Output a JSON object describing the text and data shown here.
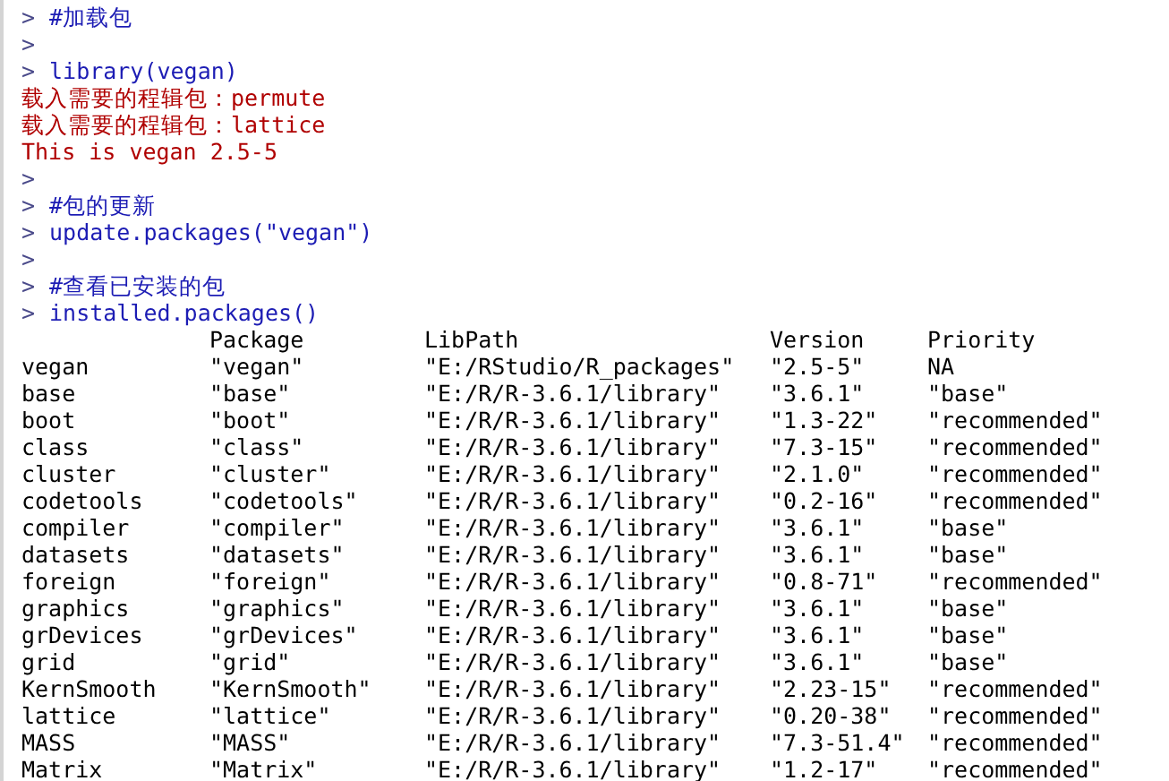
{
  "console": {
    "lines": [
      {
        "kind": "command",
        "prompt": ">",
        "text": "#加载包"
      },
      {
        "kind": "command",
        "prompt": ">"
      },
      {
        "kind": "command",
        "prompt": ">",
        "text": "library(vegan)"
      },
      {
        "kind": "message",
        "text": "载入需要的程辑包：permute"
      },
      {
        "kind": "message",
        "text": "载入需要的程辑包：lattice"
      },
      {
        "kind": "message",
        "text": "This is vegan 2.5-5"
      },
      {
        "kind": "command",
        "prompt": ">"
      },
      {
        "kind": "command",
        "prompt": ">",
        "text": "#包的更新"
      },
      {
        "kind": "command",
        "prompt": ">",
        "text": "update.packages(\"vegan\")"
      },
      {
        "kind": "command",
        "prompt": ">"
      },
      {
        "kind": "command",
        "prompt": ">",
        "text": "#查看已安装的包"
      },
      {
        "kind": "command",
        "prompt": ">",
        "text": "installed.packages()"
      }
    ],
    "table": {
      "columns": [
        "Package",
        "LibPath",
        "Version",
        "Priority"
      ],
      "rows": [
        {
          "name": "vegan",
          "cells": [
            "\"vegan\"",
            "\"E:/RStudio/R_packages\"",
            "\"2.5-5\"",
            "NA"
          ]
        },
        {
          "name": "base",
          "cells": [
            "\"base\"",
            "\"E:/R/R-3.6.1/library\"",
            "\"3.6.1\"",
            "\"base\""
          ]
        },
        {
          "name": "boot",
          "cells": [
            "\"boot\"",
            "\"E:/R/R-3.6.1/library\"",
            "\"1.3-22\"",
            "\"recommended\""
          ]
        },
        {
          "name": "class",
          "cells": [
            "\"class\"",
            "\"E:/R/R-3.6.1/library\"",
            "\"7.3-15\"",
            "\"recommended\""
          ]
        },
        {
          "name": "cluster",
          "cells": [
            "\"cluster\"",
            "\"E:/R/R-3.6.1/library\"",
            "\"2.1.0\"",
            "\"recommended\""
          ]
        },
        {
          "name": "codetools",
          "cells": [
            "\"codetools\"",
            "\"E:/R/R-3.6.1/library\"",
            "\"0.2-16\"",
            "\"recommended\""
          ]
        },
        {
          "name": "compiler",
          "cells": [
            "\"compiler\"",
            "\"E:/R/R-3.6.1/library\"",
            "\"3.6.1\"",
            "\"base\""
          ]
        },
        {
          "name": "datasets",
          "cells": [
            "\"datasets\"",
            "\"E:/R/R-3.6.1/library\"",
            "\"3.6.1\"",
            "\"base\""
          ]
        },
        {
          "name": "foreign",
          "cells": [
            "\"foreign\"",
            "\"E:/R/R-3.6.1/library\"",
            "\"0.8-71\"",
            "\"recommended\""
          ]
        },
        {
          "name": "graphics",
          "cells": [
            "\"graphics\"",
            "\"E:/R/R-3.6.1/library\"",
            "\"3.6.1\"",
            "\"base\""
          ]
        },
        {
          "name": "grDevices",
          "cells": [
            "\"grDevices\"",
            "\"E:/R/R-3.6.1/library\"",
            "\"3.6.1\"",
            "\"base\""
          ]
        },
        {
          "name": "grid",
          "cells": [
            "\"grid\"",
            "\"E:/R/R-3.6.1/library\"",
            "\"3.6.1\"",
            "\"base\""
          ]
        },
        {
          "name": "KernSmooth",
          "cells": [
            "\"KernSmooth\"",
            "\"E:/R/R-3.6.1/library\"",
            "\"2.23-15\"",
            "\"recommended\""
          ]
        },
        {
          "name": "lattice",
          "cells": [
            "\"lattice\"",
            "\"E:/R/R-3.6.1/library\"",
            "\"0.20-38\"",
            "\"recommended\""
          ]
        },
        {
          "name": "MASS",
          "cells": [
            "\"MASS\"",
            "\"E:/R/R-3.6.1/library\"",
            "\"7.3-51.4\"",
            "\"recommended\""
          ]
        },
        {
          "name": "Matrix",
          "cells": [
            "\"Matrix\"",
            "\"E:/R/R-3.6.1/library\"",
            "\"1.2-17\"",
            "\"recommended\""
          ]
        }
      ]
    }
  }
}
